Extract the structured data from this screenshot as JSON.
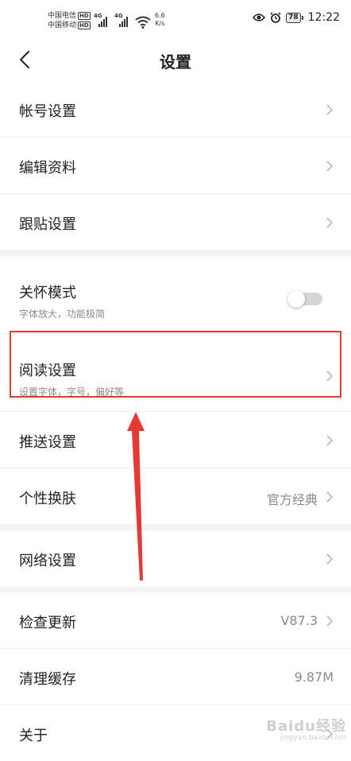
{
  "status_bar": {
    "carrier_1": "中国电信",
    "carrier_2": "中国移动",
    "hd_badge": "HD",
    "network_gen": "4G",
    "speed_value": "6.6",
    "speed_unit": "K/s",
    "battery": "78",
    "time": "12:22"
  },
  "header": {
    "title": "设置"
  },
  "items": {
    "account": {
      "label": "帐号设置"
    },
    "edit_profile": {
      "label": "编辑资料"
    },
    "follow_post": {
      "label": "跟贴设置"
    },
    "care_mode": {
      "label": "关怀模式",
      "subtitle": "字体放大，功能极简",
      "toggle_on": false
    },
    "reading": {
      "label": "阅读设置",
      "subtitle": "设置字体，字号，偏好等"
    },
    "push": {
      "label": "推送设置"
    },
    "skin": {
      "label": "个性换肤",
      "value": "官方经典"
    },
    "network": {
      "label": "网络设置"
    },
    "update": {
      "label": "检查更新",
      "value": "V87.3"
    },
    "cache": {
      "label": "清理缓存",
      "value": "9.87M"
    },
    "about": {
      "label": "关于"
    }
  },
  "watermark": {
    "main": "Baidu经验",
    "sub": "jingyan.baidu.com"
  },
  "colors": {
    "highlight": "#e53935",
    "separator": "#f3f3f3"
  }
}
